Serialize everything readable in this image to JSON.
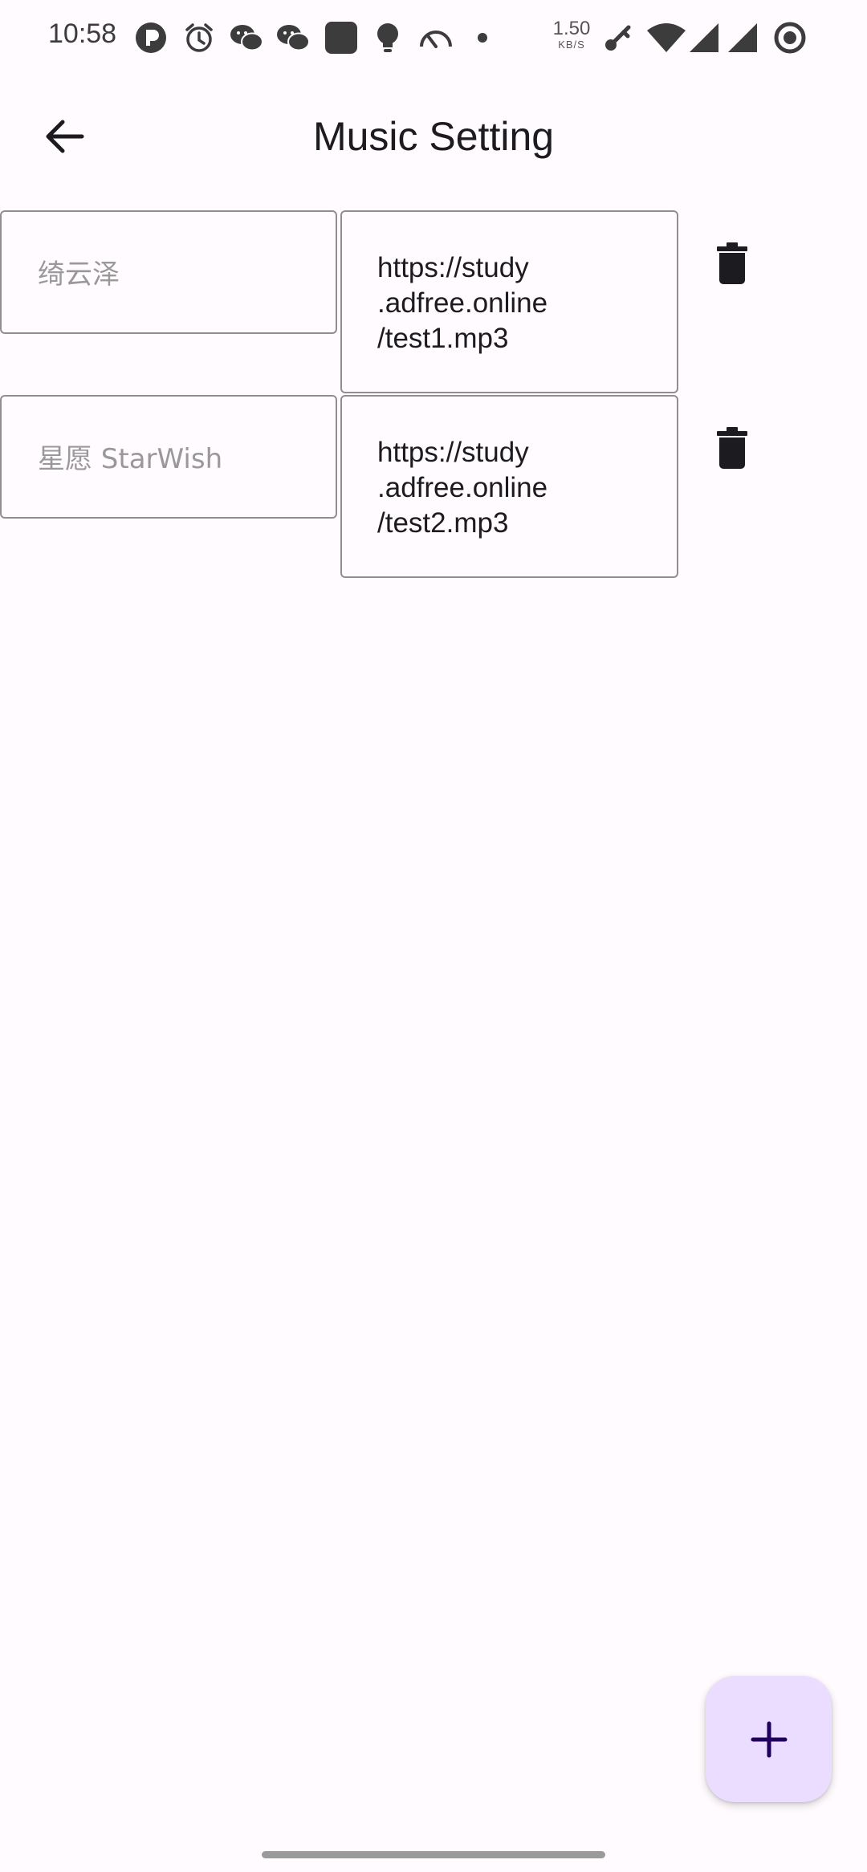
{
  "status_bar": {
    "time": "10:58",
    "net_speed_value": "1.50",
    "net_speed_unit": "KB/S",
    "icons": [
      "p-app-icon",
      "alarm-icon",
      "wechat-icon",
      "wechat-icon",
      "app-square-icon",
      "bulb-icon",
      "speedometer-icon",
      "dot-icon",
      "key-icon",
      "wifi-icon",
      "signal-icon",
      "signal-icon",
      "record-icon"
    ]
  },
  "app_bar": {
    "title": "Music Setting",
    "back_icon": "arrow-left-icon"
  },
  "music_list": [
    {
      "name_placeholder": "绮云泽",
      "url": "https://study\n.adfree.online\n/test1.mp3",
      "delete_icon": "trash-icon"
    },
    {
      "name_placeholder": "星愿 StarWish",
      "url": "https://study\n.adfree.online\n/test2.mp3",
      "delete_icon": "trash-icon"
    }
  ],
  "fab": {
    "icon": "plus-icon",
    "color": "#EADDFF",
    "icon_color": "#21005D"
  },
  "colors": {
    "background": "#FFFBFE",
    "text": "#1C1B1F",
    "outline": "#8E8E93"
  }
}
